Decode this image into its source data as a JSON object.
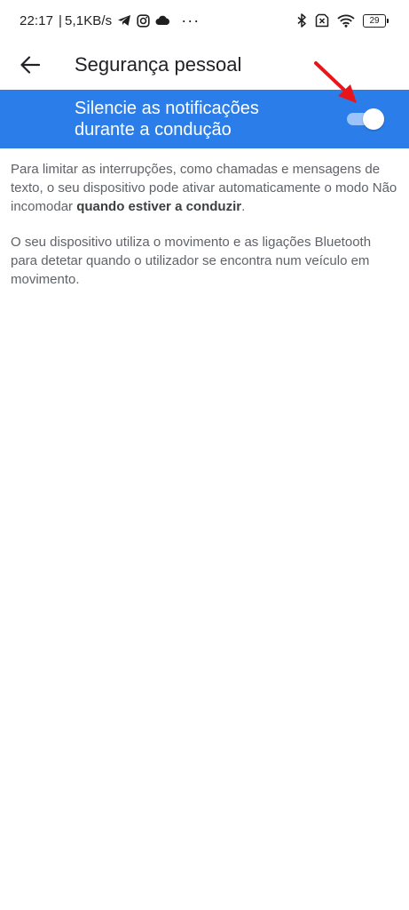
{
  "status_bar": {
    "time": "22:17",
    "separator": "|",
    "net_speed": "5,1KB/s",
    "more": "···",
    "battery_level": "29",
    "icons": [
      "telegram-icon",
      "instagram-icon",
      "cloud-icon",
      "bluetooth-icon",
      "sim-disabled-icon",
      "wifi-icon",
      "battery-icon"
    ]
  },
  "app_bar": {
    "back_icon": "back-arrow-icon",
    "title": "Segurança pessoal"
  },
  "toggle": {
    "label": "Silencie as notificações durante a condução",
    "state": "on",
    "row_color": "#2b7de9"
  },
  "annotation": {
    "icon": "red-arrow-icon",
    "color": "#e8161b"
  },
  "description": {
    "para1_before": "Para limitar as interrupções, como chamadas e mensagens de texto, o seu dispositivo pode ativar automaticamente o modo Não incomodar ",
    "para1_bold": "quando estiver a conduzir",
    "para1_after": ".",
    "para2": "O seu dispositivo utiliza o movimento e as ligações Bluetooth para detetar quando o utilizador se encontra num veículo em movimento."
  }
}
